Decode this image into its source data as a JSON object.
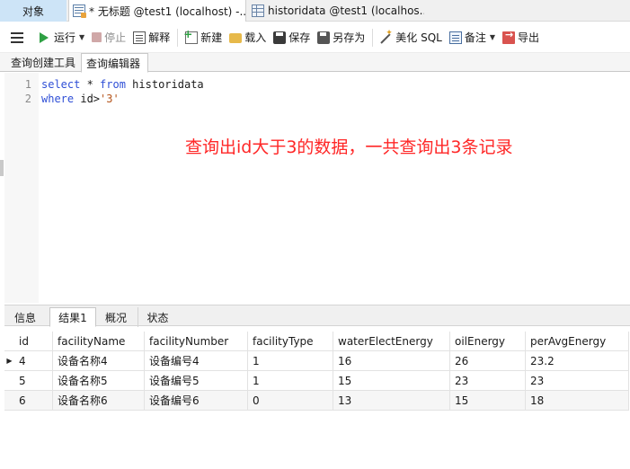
{
  "tabs": {
    "objects": "对象",
    "query": "* 无标题 @test1 (localhost) -...",
    "table": "historidata @test1 (localhos..."
  },
  "toolbar": {
    "run": "运行",
    "stop": "停止",
    "explain": "解释",
    "new": "新建",
    "load": "载入",
    "save": "保存",
    "save_as": "另存为",
    "beautify": "美化 SQL",
    "note": "备注",
    "export": "导出"
  },
  "subtabs": {
    "builder": "查询创建工具",
    "editor": "查询编辑器"
  },
  "editor": {
    "line_numbers": [
      "1",
      "2"
    ],
    "line1": {
      "kw1": "select",
      "mid": " * ",
      "kw2": "from",
      "rest": " historidata"
    },
    "line2": {
      "kw1": "where",
      "mid": " id>",
      "str": "'3'"
    },
    "annotation": "查询出id大于3的数据，一共查询出3条记录"
  },
  "result_tabs": {
    "info": "信息",
    "result1": "结果1",
    "profile": "概况",
    "status": "状态"
  },
  "grid": {
    "columns": [
      "id",
      "facilityName",
      "facilityNumber",
      "facilityType",
      "waterElectEnergy",
      "oilEnergy",
      "perAvgEnergy"
    ],
    "rows": [
      [
        "4",
        "设备名称4",
        "设备编号4",
        "1",
        "16",
        "26",
        "23.2"
      ],
      [
        "5",
        "设备名称5",
        "设备编号5",
        "1",
        "15",
        "23",
        "23"
      ],
      [
        "6",
        "设备名称6",
        "设备编号6",
        "0",
        "13",
        "15",
        "18"
      ]
    ]
  }
}
